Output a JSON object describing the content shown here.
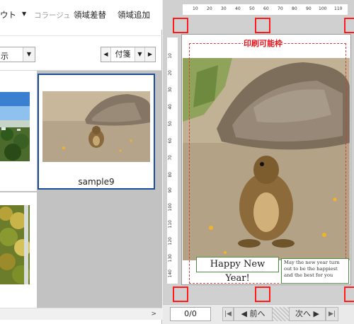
{
  "toolbar": {
    "layout_label": "ウト",
    "collage_label": "コラージュ",
    "replace_area_label": "領域差替",
    "add_area_label": "領域追加"
  },
  "view": {
    "display_select_value": "示",
    "tag_nav_label": "付箋"
  },
  "thumbnails": {
    "selected_caption": "sample9"
  },
  "preview": {
    "print_area_label": "印刷可能枠",
    "greeting_text": "Happy New Year!",
    "message_text": "May the new year turn out to be the happiest and the best for you",
    "ruler_top_labels": [
      "10",
      "20",
      "30",
      "40",
      "50",
      "60",
      "70",
      "80",
      "90",
      "100",
      "110"
    ],
    "ruler_left_labels": [
      "10",
      "20",
      "30",
      "40",
      "50",
      "60",
      "70",
      "80",
      "90",
      "100",
      "110",
      "120",
      "130",
      "140"
    ]
  },
  "navigation": {
    "page_counter": "0/0",
    "prev_label": "前へ",
    "next_label": "次へ",
    "first_icon": "first-page-icon",
    "last_icon": "last-page-icon"
  },
  "colors": {
    "selection_border": "#1c4e94",
    "handle_red": "#ff1b1b",
    "print_area_red": "#e8141c",
    "text_frame_green": "#4a8f3f"
  }
}
